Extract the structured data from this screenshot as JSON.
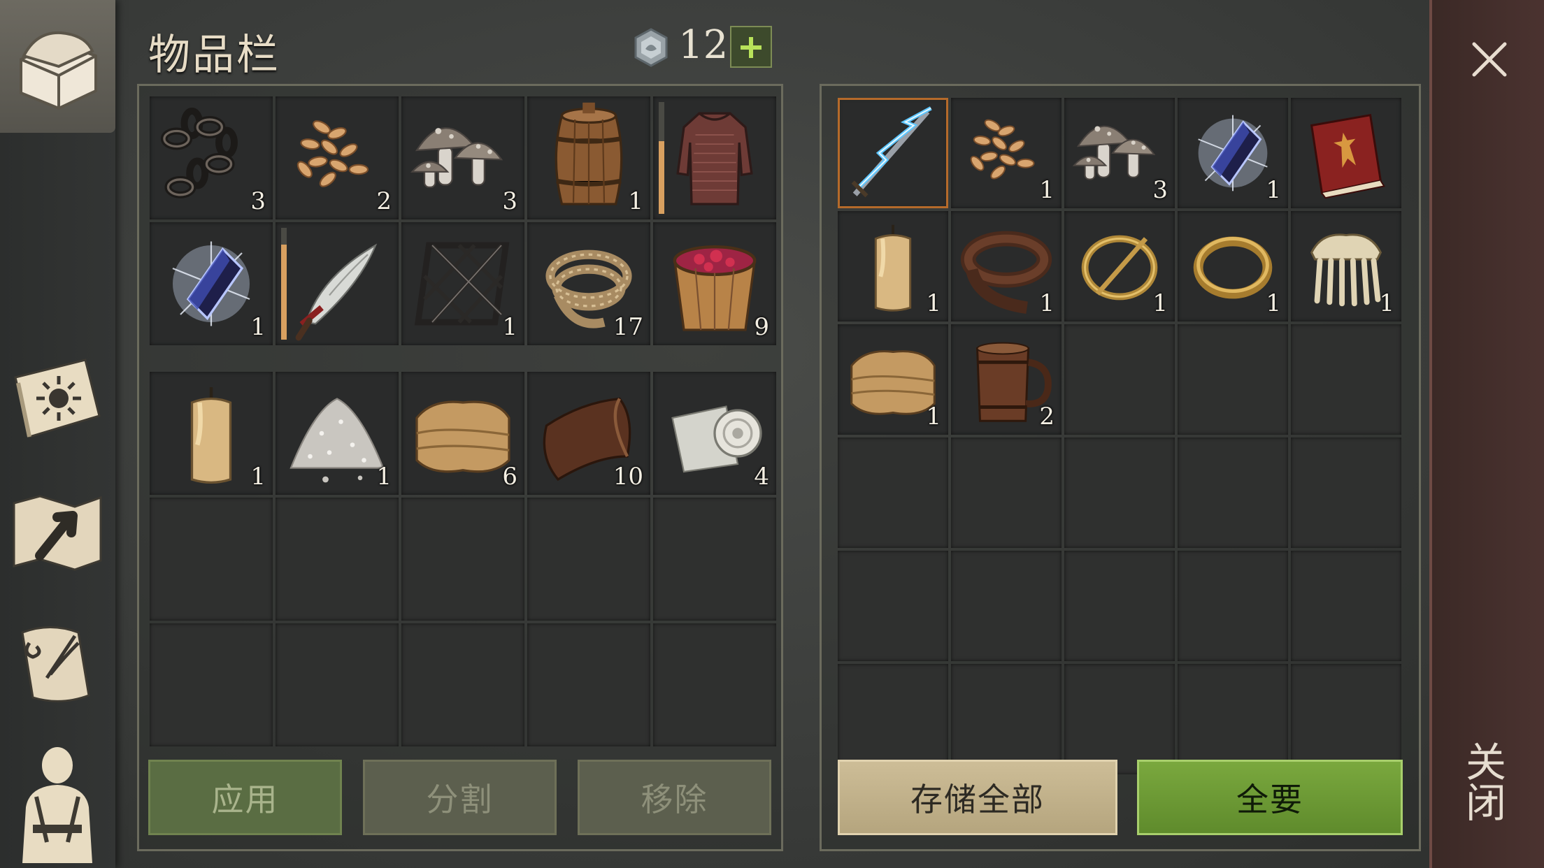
{
  "title": "物品栏",
  "currency": {
    "amount": "12"
  },
  "close_label": "关闭",
  "inventory": {
    "items": [
      {
        "name": "chain",
        "qty": "3"
      },
      {
        "name": "seeds",
        "qty": "2"
      },
      {
        "name": "mushrooms",
        "qty": "3"
      },
      {
        "name": "barrel",
        "qty": "1"
      },
      {
        "name": "chainmail",
        "qty": "",
        "durability": 0.65
      },
      {
        "name": "crystal",
        "qty": "1"
      },
      {
        "name": "scimitar",
        "qty": "",
        "durability": 0.85
      },
      {
        "name": "iron-grate",
        "qty": "1"
      },
      {
        "name": "rope",
        "qty": "17"
      },
      {
        "name": "berry-bucket",
        "qty": "9"
      },
      {
        "name": "candle",
        "qty": "1"
      },
      {
        "name": "salt-pile",
        "qty": "1"
      },
      {
        "name": "cloth",
        "qty": "6"
      },
      {
        "name": "leather",
        "qty": "10"
      },
      {
        "name": "bandage",
        "qty": "4"
      }
    ],
    "buttons": {
      "apply": "应用",
      "split": "分割",
      "remove": "移除"
    }
  },
  "storage": {
    "items": [
      {
        "name": "lightning-sword",
        "qty": "",
        "selected": true
      },
      {
        "name": "seeds",
        "qty": "1"
      },
      {
        "name": "mushrooms",
        "qty": "3"
      },
      {
        "name": "crystal",
        "qty": "1"
      },
      {
        "name": "red-book",
        "qty": ""
      },
      {
        "name": "candle",
        "qty": "1"
      },
      {
        "name": "leather-belt",
        "qty": "1"
      },
      {
        "name": "brooch",
        "qty": "1"
      },
      {
        "name": "gold-ring",
        "qty": "1"
      },
      {
        "name": "bone-comb",
        "qty": "1"
      },
      {
        "name": "cloth",
        "qty": "1"
      },
      {
        "name": "wooden-mug",
        "qty": "2"
      }
    ],
    "buttons": {
      "store_all": "存储全部",
      "take_all": "全要"
    }
  }
}
